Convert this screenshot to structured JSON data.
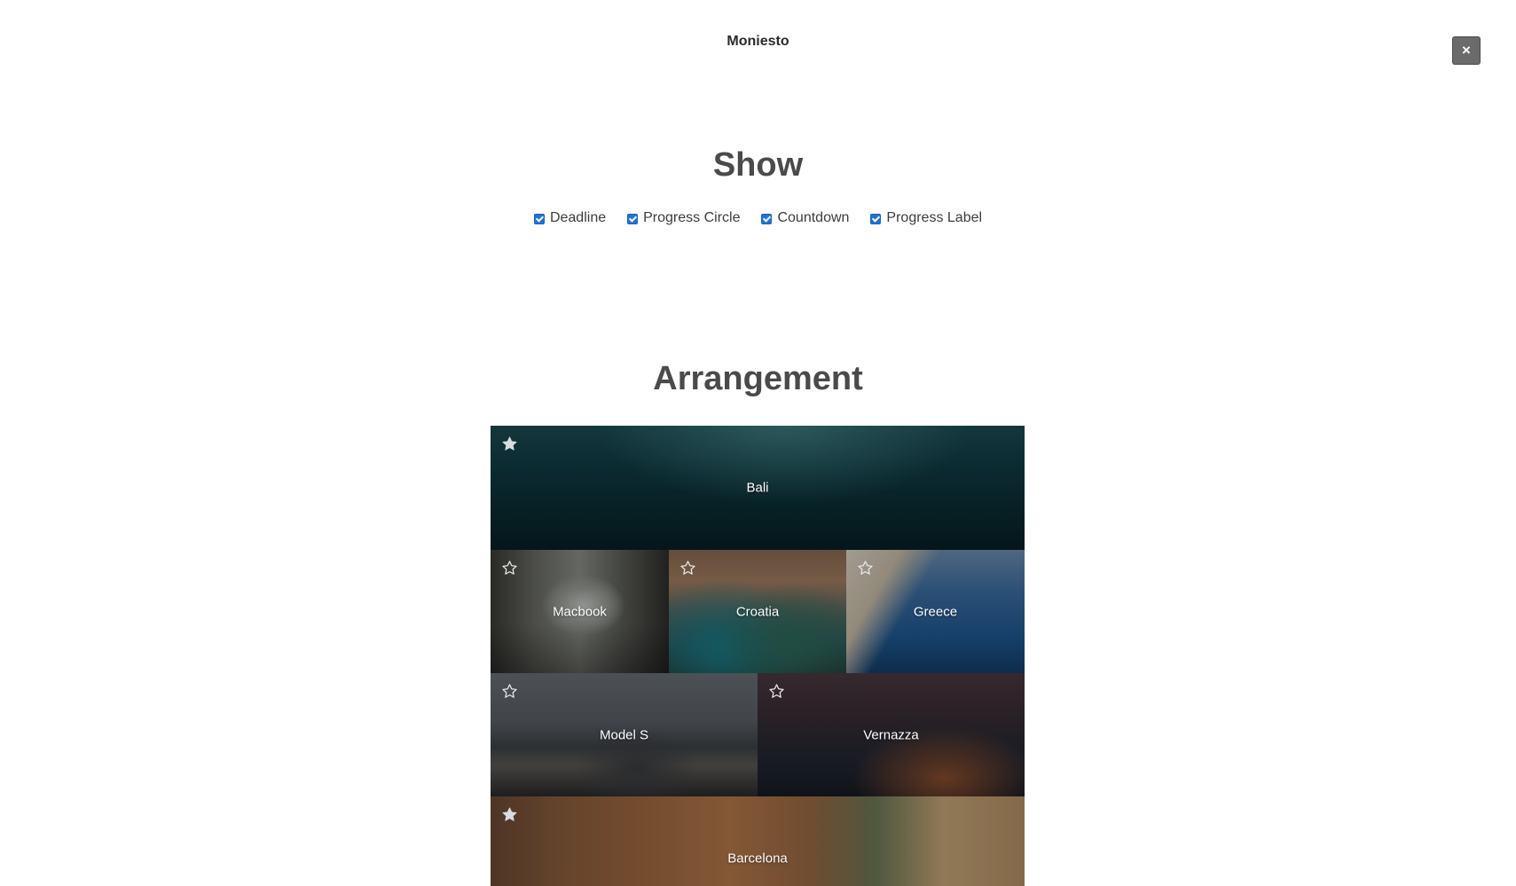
{
  "header": {
    "app_title": "Moniesto",
    "close_label": "×"
  },
  "show": {
    "title": "Show",
    "options": [
      {
        "label": "Deadline",
        "checked": true
      },
      {
        "label": "Progress Circle",
        "checked": true
      },
      {
        "label": "Countdown",
        "checked": true
      },
      {
        "label": "Progress Label",
        "checked": true
      }
    ]
  },
  "arrangement": {
    "title": "Arrangement",
    "tiles": [
      {
        "label": "Bali",
        "starred": true
      },
      {
        "label": "Macbook",
        "starred": false
      },
      {
        "label": "Croatia",
        "starred": false
      },
      {
        "label": "Greece",
        "starred": false
      },
      {
        "label": "Model S",
        "starred": false
      },
      {
        "label": "Vernazza",
        "starred": false
      },
      {
        "label": "Barcelona",
        "starred": true
      }
    ]
  },
  "colors": {
    "checkbox_accent": "#1e74d6",
    "close_button": "#6b6b6b",
    "heading_text": "#4a4a4a"
  },
  "icons": {
    "star_filled": "star-filled-icon",
    "star_outline": "star-outline-icon",
    "close": "close-icon",
    "checkbox": "checkbox-checked-icon"
  }
}
